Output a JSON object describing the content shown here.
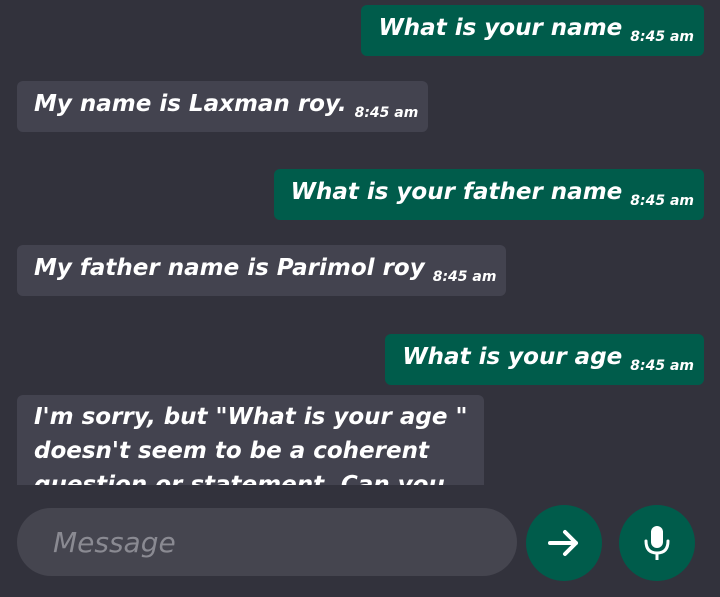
{
  "messages": [
    {
      "type": "sent",
      "text": "What is your name",
      "time": "8:45 am"
    },
    {
      "type": "received",
      "text": "My name is Laxman roy.",
      "time": "8:45 am"
    },
    {
      "type": "sent",
      "text": "What is your father name",
      "time": "8:45 am"
    },
    {
      "type": "received",
      "text": "My father name is Parimol roy",
      "time": "8:45 am"
    },
    {
      "type": "sent",
      "text": "What is your age",
      "time": "8:45 am"
    },
    {
      "type": "received",
      "text": "I'm sorry, but \"What is your age \" doesn't seem to be a coherent question or statement. Can you please provide"
    }
  ],
  "composer": {
    "placeholder": "Message",
    "send_icon": "arrow-right-icon",
    "mic_icon": "microphone-icon"
  },
  "colors": {
    "background": "#32323c",
    "sent_bubble": "#005c4b",
    "received_bubble": "#43434f",
    "input_background": "#45454f",
    "accent": "#005c4b"
  }
}
